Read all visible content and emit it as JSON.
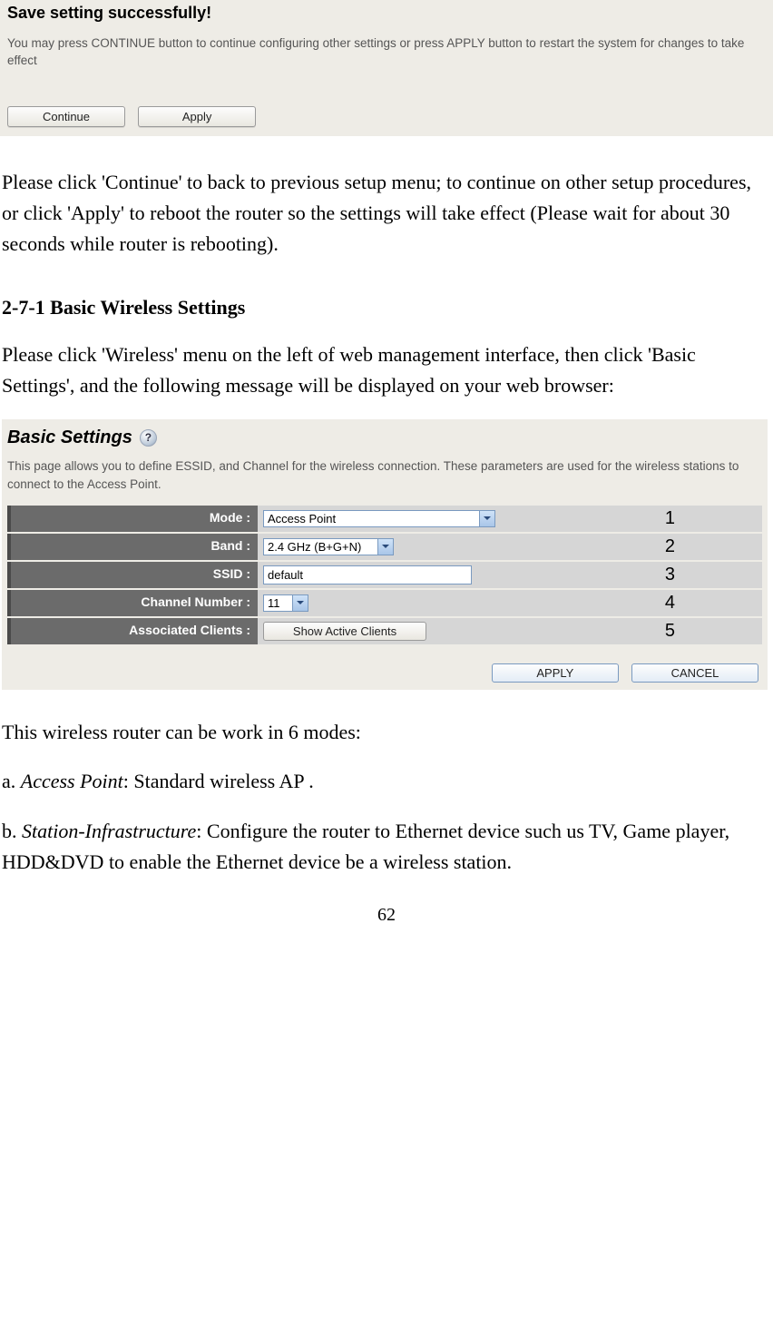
{
  "screenshot1": {
    "title": "Save setting successfully!",
    "subtext": "You may press CONTINUE button to continue configuring other settings or press APPLY button to restart the system for changes to take effect",
    "continue_label": "Continue",
    "apply_label": "Apply"
  },
  "para1": "Please click 'Continue' to back to previous setup menu; to continue on other setup procedures, or click 'Apply' to reboot the router so the settings will take effect (Please wait for about 30 seconds while router is rebooting).",
  "section_title": "2-7-1 Basic Wireless Settings",
  "para2": "Please click 'Wireless' menu on the left of web management interface, then click 'Basic Settings', and the following message will be displayed on your web browser:",
  "screenshot2": {
    "title": "Basic Settings",
    "desc": "This page allows you to define ESSID, and Channel for the wireless connection. These parameters are used for the wireless stations to connect to the Access Point.",
    "rows": {
      "mode": {
        "label": "Mode :",
        "value": "Access Point",
        "annot": "1"
      },
      "band": {
        "label": "Band :",
        "value": "2.4 GHz (B+G+N)",
        "annot": "2"
      },
      "ssid": {
        "label": "SSID :",
        "value": "default",
        "annot": "3"
      },
      "channel": {
        "label": "Channel Number :",
        "value": "11",
        "annot": "4"
      },
      "clients": {
        "label": "Associated Clients :",
        "button": "Show Active Clients",
        "annot": "5"
      }
    },
    "apply_label": "APPLY",
    "cancel_label": "CANCEL"
  },
  "para3": "This wireless router can be work in 6 modes:",
  "mode_a_prefix": "a. ",
  "mode_a_name": "Access Point",
  "mode_a_rest": ": Standard wireless AP .",
  "mode_b_prefix": "b. ",
  "mode_b_name": "Station-Infrastructure",
  "mode_b_rest": ": Configure the router to Ethernet device such us TV, Game player, HDD&DVD to enable the Ethernet device be a wireless station.",
  "page_number": "62"
}
